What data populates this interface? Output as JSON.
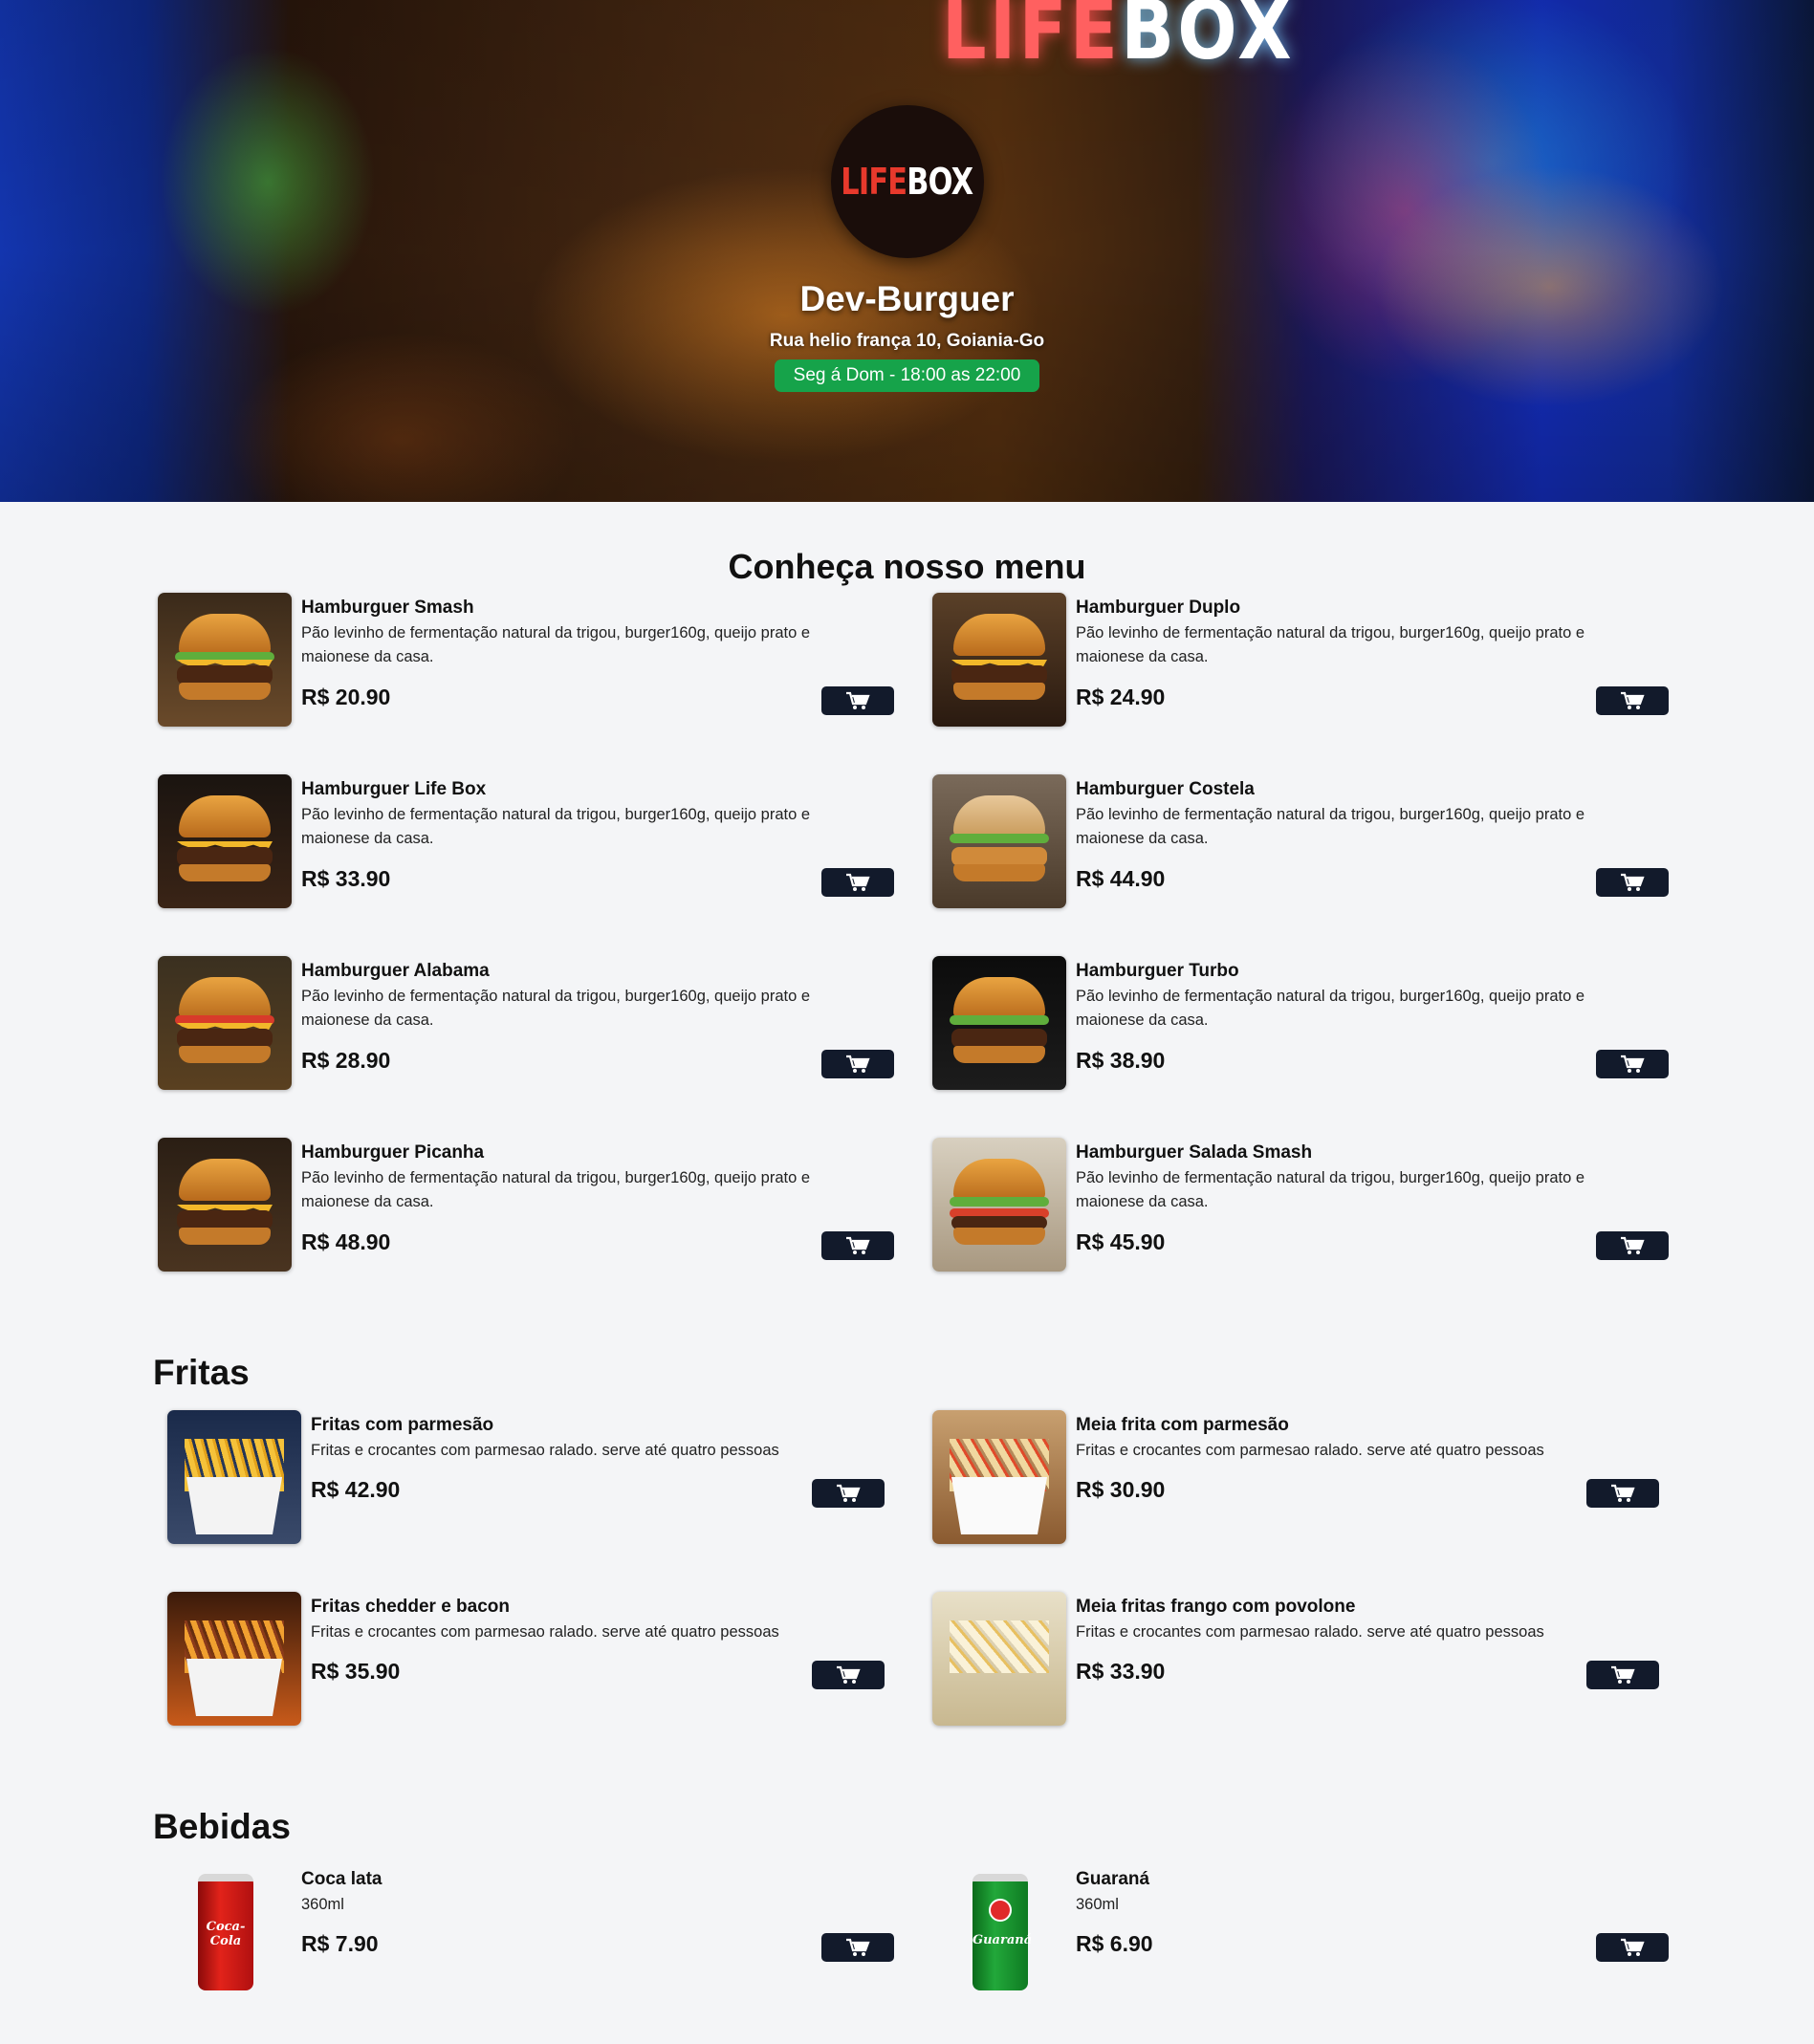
{
  "hero": {
    "sign_red": "LIFE",
    "sign_white": "BOX",
    "logo_red": "LIFE",
    "logo_white": "BOX",
    "title": "Dev-Burguer",
    "address": "Rua helio frança 10, Goiania-Go",
    "hours": "Seg á Dom - 18:00 as 22:00"
  },
  "colors": {
    "accent_green": "#16a34a",
    "button_dark": "#121a2b",
    "page_bg": "#f4f5f7"
  },
  "menu": {
    "title": "Conheça nosso menu",
    "items": [
      {
        "name": "Hamburguer Smash",
        "desc": "Pão levinho de fermentação natural da trigou, burger160g, queijo prato e maionese da casa.",
        "price": "R$ 20.90"
      },
      {
        "name": "Hamburguer Duplo",
        "desc": "Pão levinho de fermentação natural da trigou, burger160g, queijo prato e maionese da casa.",
        "price": "R$ 24.90"
      },
      {
        "name": "Hamburguer Life Box",
        "desc": "Pão levinho de fermentação natural da trigou, burger160g, queijo prato e maionese da casa.",
        "price": "R$ 33.90"
      },
      {
        "name": "Hamburguer Costela",
        "desc": "Pão levinho de fermentação natural da trigou, burger160g, queijo prato e maionese da casa.",
        "price": "R$ 44.90"
      },
      {
        "name": "Hamburguer Alabama",
        "desc": "Pão levinho de fermentação natural da trigou, burger160g, queijo prato e maionese da casa.",
        "price": "R$ 28.90"
      },
      {
        "name": "Hamburguer Turbo",
        "desc": "Pão levinho de fermentação natural da trigou, burger160g, queijo prato e maionese da casa.",
        "price": "R$ 38.90"
      },
      {
        "name": "Hamburguer Picanha",
        "desc": "Pão levinho de fermentação natural da trigou, burger160g, queijo prato e maionese da casa.",
        "price": "R$ 48.90"
      },
      {
        "name": "Hamburguer Salada Smash",
        "desc": "Pão levinho de fermentação natural da trigou, burger160g, queijo prato e maionese da casa.",
        "price": "R$ 45.90"
      }
    ]
  },
  "fritas": {
    "title": "Fritas",
    "items": [
      {
        "name": "Fritas com parmesão",
        "desc": "Fritas e crocantes com parmesao ralado. serve até quatro pessoas",
        "price": "R$ 42.90"
      },
      {
        "name": "Meia frita com parmesão",
        "desc": "Fritas e crocantes com parmesao ralado. serve até quatro pessoas",
        "price": "R$ 30.90"
      },
      {
        "name": "Fritas chedder e bacon",
        "desc": "Fritas e crocantes com parmesao ralado. serve até quatro pessoas",
        "price": "R$ 35.90"
      },
      {
        "name": "Meia fritas frango com povolone",
        "desc": "Fritas e crocantes com parmesao ralado. serve até quatro pessoas",
        "price": "R$ 33.90"
      }
    ]
  },
  "bebidas": {
    "title": "Bebidas",
    "items": [
      {
        "name": "Coca lata",
        "desc": "360ml",
        "price": "R$ 7.90",
        "can_label": "Coca-Cola"
      },
      {
        "name": "Guaraná",
        "desc": "360ml",
        "price": "R$ 6.90",
        "can_label": "Guaraná"
      }
    ]
  }
}
